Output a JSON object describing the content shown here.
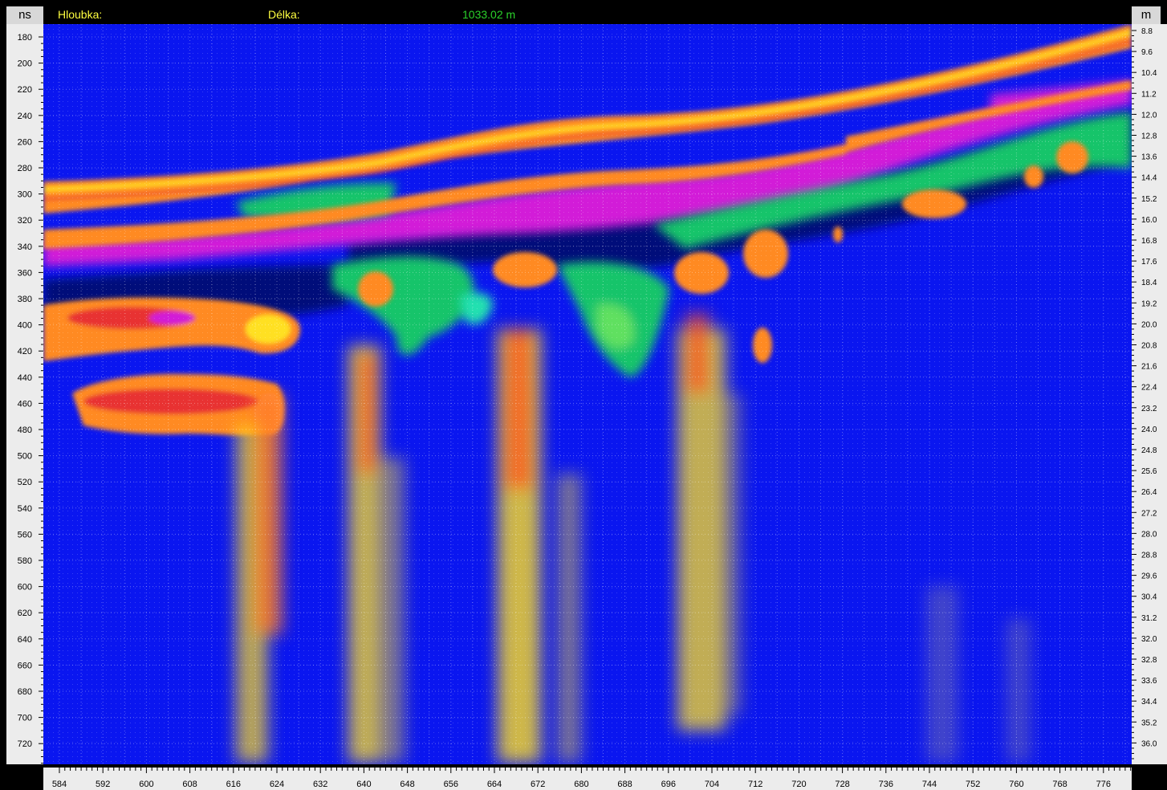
{
  "header": {
    "depth_label": "Hloubka:",
    "length_label": "Délka:",
    "length_value": "1033.02 m",
    "left_unit": "ns",
    "right_unit": "m"
  },
  "axes": {
    "left_ticks": [
      "180",
      "200",
      "220",
      "240",
      "260",
      "280",
      "300",
      "320",
      "340",
      "360",
      "380",
      "400",
      "420",
      "440",
      "460",
      "480",
      "500",
      "520",
      "540",
      "560",
      "580",
      "600",
      "620",
      "640",
      "660",
      "680",
      "700",
      "720"
    ],
    "right_ticks": [
      "8.8",
      "9.6",
      "10.4",
      "11.2",
      "12.0",
      "12.8",
      "13.6",
      "14.4",
      "15.2",
      "16.0",
      "16.8",
      "17.6",
      "18.4",
      "19.2",
      "20.0",
      "20.8",
      "21.6",
      "22.4",
      "23.2",
      "24.0",
      "24.8",
      "25.6",
      "26.4",
      "27.2",
      "28.0",
      "28.8",
      "29.6",
      "30.4",
      "31.2",
      "32.0",
      "32.8",
      "33.6",
      "34.4",
      "35.2",
      "36.0"
    ],
    "bottom_ticks": [
      "584",
      "592",
      "600",
      "608",
      "616",
      "624",
      "632",
      "640",
      "648",
      "656",
      "664",
      "672",
      "680",
      "688",
      "696",
      "704",
      "712",
      "720",
      "728",
      "736",
      "744",
      "752",
      "760",
      "768",
      "776"
    ]
  },
  "colors": {
    "background": "#0a16f0",
    "deep": "#000c7a",
    "magenta": "#d21ad8",
    "orange": "#ff8a24",
    "yellow": "#ffe020",
    "red": "#e83030",
    "green": "#12c46a",
    "header_yellow": "#ffff40",
    "header_green": "#2bd12b"
  }
}
